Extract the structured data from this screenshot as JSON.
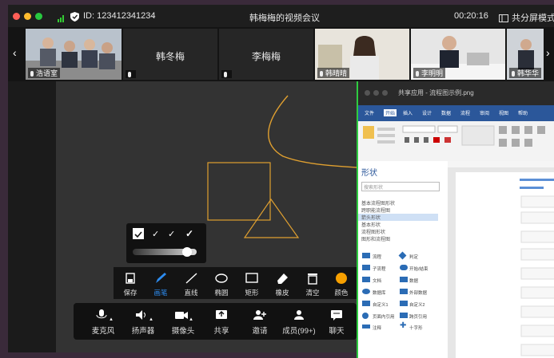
{
  "window": {
    "meeting_id": "ID: 123412341234",
    "title": "韩梅梅的视频会议",
    "timer": "00:20:16",
    "layout_button": "共分屏模式"
  },
  "participants": [
    {
      "name": "浩语室"
    },
    {
      "name": "韩冬梅"
    },
    {
      "name": "李梅梅"
    },
    {
      "name": "韩晴晴"
    },
    {
      "name": "李明明"
    },
    {
      "name": "韩华华"
    }
  ],
  "annotation_toolbar": {
    "items": [
      {
        "label": "保存",
        "icon": "save-icon"
      },
      {
        "label": "画笔",
        "icon": "pen-icon"
      },
      {
        "label": "直线",
        "icon": "line-icon"
      },
      {
        "label": "椭圆",
        "icon": "ellipse-icon"
      },
      {
        "label": "矩形",
        "icon": "rectangle-icon"
      },
      {
        "label": "橡皮",
        "icon": "eraser-icon"
      },
      {
        "label": "清空",
        "icon": "trash-icon"
      },
      {
        "label": "颜色",
        "icon": "color-icon"
      }
    ],
    "active_color": "#f7a000"
  },
  "meeting_toolbar": {
    "items": [
      {
        "label": "麦克风",
        "icon": "microphone-icon"
      },
      {
        "label": "扬声器",
        "icon": "speaker-icon"
      },
      {
        "label": "摄像头",
        "icon": "camera-icon"
      },
      {
        "label": "共享",
        "icon": "share-icon"
      },
      {
        "label": "邀请",
        "icon": "invite-icon"
      },
      {
        "label": "成员(99+)",
        "icon": "members-icon"
      },
      {
        "label": "聊天",
        "icon": "chat-icon"
      }
    ]
  },
  "shared_window": {
    "title": "共享应用 - 流程图示例.png",
    "tabs": [
      "文件",
      "开始",
      "插入",
      "设计",
      "数据",
      "流程",
      "审阅",
      "视图",
      "帮助"
    ],
    "pane_title": "形状",
    "search_placeholder": "搜索形状",
    "categories": [
      "基本流程图形状",
      "跨职能流程图",
      "箭头形状",
      "基本形状",
      "流程图形状",
      "图形和流程图"
    ],
    "shapes": [
      "流程",
      "判定",
      "子流程",
      "开始/结束",
      "文档",
      "数据",
      "数据库",
      "外部数据",
      "自定义1",
      "自定义2",
      "页面内引用",
      "跨页引用",
      "注释",
      "十字形"
    ]
  },
  "colors": {
    "accent": "#2d8cf0",
    "drawing": "#e0a030",
    "share_border": "#2ecc40"
  }
}
